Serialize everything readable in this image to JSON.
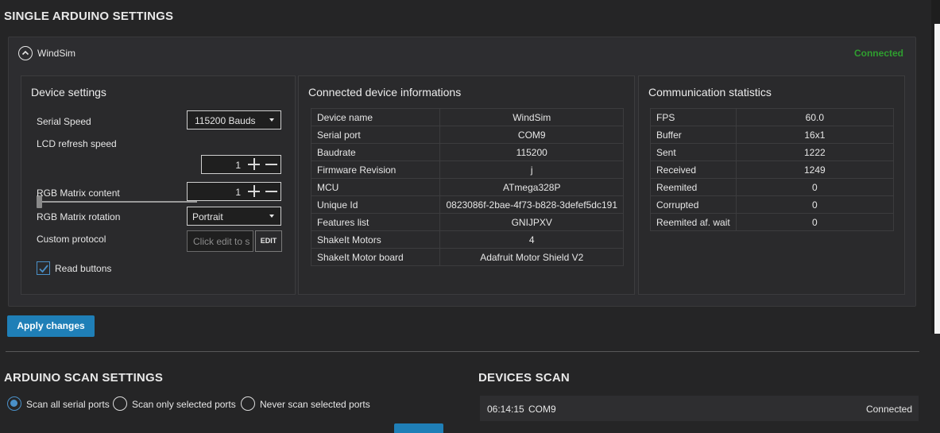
{
  "page": {
    "single_settings_title": "SINGLE ARDUINO SETTINGS",
    "scan_settings_title": "ARDUINO SCAN SETTINGS",
    "devices_scan_title": "DEVICES SCAN"
  },
  "device_panel": {
    "name": "WindSim",
    "status": "Connected",
    "status_color": "#2f9e2f"
  },
  "device_settings": {
    "title": "Device settings",
    "serial_speed_label": "Serial Speed",
    "serial_speed_value": "115200 Bauds",
    "lcd_refresh_label": "LCD refresh speed",
    "lcd_refresh_value": "1",
    "lcd_refresh_slider_level": 0,
    "rgb_content_label": "RGB Matrix content",
    "rgb_content_value": "1",
    "rgb_rotation_label": "RGB Matrix rotation",
    "rgb_rotation_value": "Portrait",
    "custom_protocol_label": "Custom protocol",
    "custom_protocol_placeholder": "Click edit to s",
    "edit_label": "EDIT",
    "read_buttons_label": "Read buttons",
    "read_buttons_checked": true
  },
  "device_info": {
    "title": "Connected device informations",
    "rows": [
      {
        "key": "Device name",
        "value": "WindSim"
      },
      {
        "key": "Serial port",
        "value": "COM9"
      },
      {
        "key": "Baudrate",
        "value": "115200"
      },
      {
        "key": "Firmware Revision",
        "value": "j"
      },
      {
        "key": "MCU",
        "value": "ATmega328P"
      },
      {
        "key": "Unique Id",
        "value": "0823086f-2bae-4f73-b828-3defef5dc191"
      },
      {
        "key": "Features list",
        "value": "GNIJPXV"
      },
      {
        "key": "ShakeIt Motors",
        "value": "4"
      },
      {
        "key": "ShakeIt Motor board",
        "value": "Adafruit Motor Shield V2"
      }
    ]
  },
  "comm_stats": {
    "title": "Communication statistics",
    "rows": [
      {
        "key": "FPS",
        "value": "60.0"
      },
      {
        "key": "Buffer",
        "value": "16x1"
      },
      {
        "key": "Sent",
        "value": "1222"
      },
      {
        "key": "Received",
        "value": "1249"
      },
      {
        "key": "Reemited",
        "value": "0"
      },
      {
        "key": "Corrupted",
        "value": "0"
      },
      {
        "key": "Reemited af. wait",
        "value": "0"
      }
    ]
  },
  "apply_label": "Apply changes",
  "scan_options": {
    "all": "Scan all serial ports",
    "selected": "Scan only selected ports",
    "never": "Never scan selected ports",
    "current": "all"
  },
  "scan_log": [
    {
      "time": "06:14:15",
      "port": "COM9",
      "status": "Connected"
    }
  ],
  "colors": {
    "accent": "#1f7fb7",
    "background": "#252526"
  }
}
